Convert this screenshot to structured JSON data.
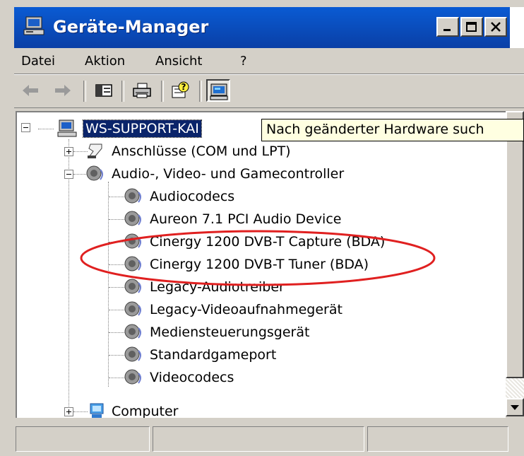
{
  "window": {
    "title": "Geräte-Manager",
    "title_icon": "computer-icon",
    "title_bar_color": "#0a3fa6"
  },
  "menu": {
    "items": [
      "Datei",
      "Aktion",
      "Ansicht",
      "?"
    ]
  },
  "toolbar": {
    "buttons": [
      "back-arrow-icon",
      "forward-arrow-icon",
      "console-tree-icon",
      "print-icon",
      "help-icon",
      "scan-hardware-icon"
    ]
  },
  "tooltip": {
    "text": "Nach geänderter Hardware such"
  },
  "tree": {
    "root": "WS-SUPPORT-KAI",
    "nodes": [
      {
        "label": "Anschlüsse (COM und LPT)",
        "icon": "port-icon",
        "expander": "plus"
      },
      {
        "label": "Audio-, Video- und Gamecontroller",
        "icon": "sound-icon",
        "expander": "minus"
      },
      {
        "label": "Computer",
        "icon": "computer-monitor-icon",
        "expander": "plus"
      }
    ],
    "children": [
      "Audiocodecs",
      "Aureon 7.1 PCI Audio Device",
      "Cinergy 1200 DVB-T Capture (BDA)",
      "Cinergy 1200 DVB-T Tuner (BDA)",
      "Legacy-Audiotreiber",
      "Legacy-Videoaufnahmegerät",
      "Mediensteuerungsgerät",
      "Standardgameport",
      "Videocodecs"
    ]
  },
  "annotation": {
    "color": "#e02020",
    "highlighted": [
      "Cinergy 1200 DVB-T Capture (BDA)",
      "Cinergy 1200 DVB-T Tuner (BDA)"
    ]
  }
}
